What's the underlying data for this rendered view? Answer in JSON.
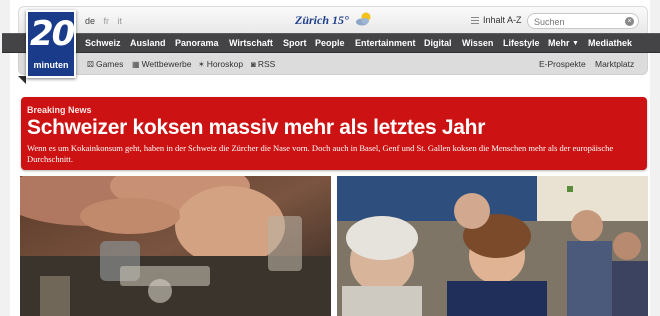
{
  "header": {
    "languages": [
      "de",
      "fr",
      "it"
    ],
    "weather": "Zürich 15°",
    "weather_icon": "sun-cloud-icon",
    "inhalt_label": "Inhalt A-Z",
    "search_placeholder": "Suchen",
    "logo_number": "20",
    "logo_text": "minuten",
    "brand_color": "#1a3a8a"
  },
  "nav": {
    "items": [
      "Schweiz",
      "Ausland",
      "Panorama",
      "Wirtschaft",
      "Sport",
      "People",
      "Entertainment",
      "Digital",
      "Wissen",
      "Lifestyle",
      "Mehr",
      "Mediathek"
    ],
    "more_icon": "chevron-down-icon"
  },
  "subnav": {
    "left": [
      {
        "icon": "dice-icon",
        "label": "Games"
      },
      {
        "icon": "grid-icon",
        "label": "Wettbewerbe"
      },
      {
        "icon": "star-icon",
        "label": "Horoskop"
      },
      {
        "icon": "rss-icon",
        "label": "RSS"
      }
    ],
    "right": [
      "E-Prospekte",
      "Marktplatz"
    ]
  },
  "breaking": {
    "label": "Breaking News",
    "title": "Schweizer koksen massiv mehr als letztes Jahr",
    "lead": "Wenn es um Kokainkonsum geht, haben in der Schweiz die Zürcher die Nase vorn. Doch auch in Basel, Genf und St. Gallen koksen die Menschen mehr als der europäische Durchschnitt.",
    "color": "#cc1212"
  }
}
